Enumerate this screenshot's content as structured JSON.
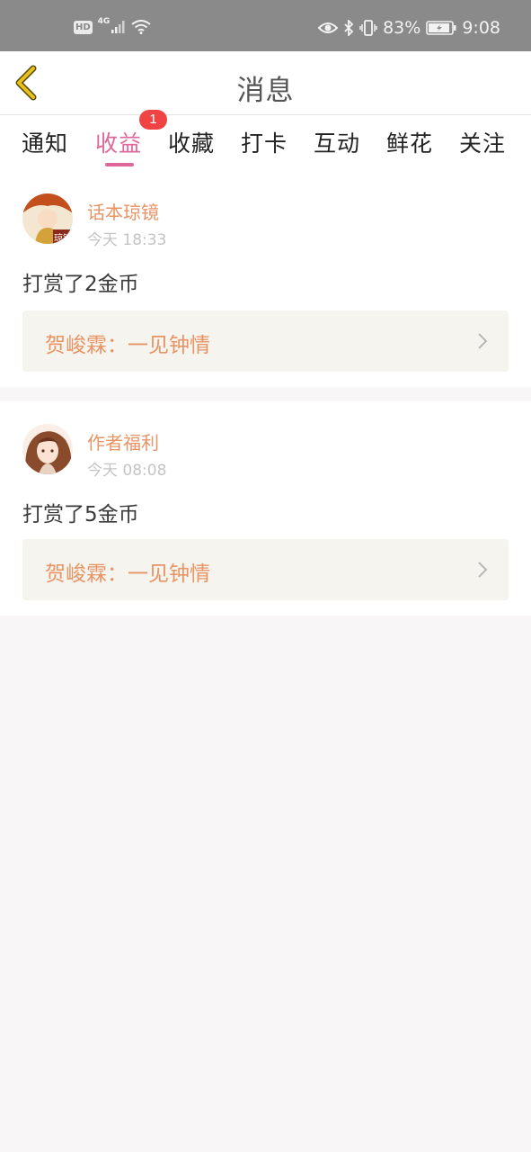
{
  "status_bar": {
    "left_indicators": [
      "HD",
      "4G"
    ],
    "battery": "83%",
    "time": "9:08",
    "icons": [
      "signal-icon",
      "wifi-icon",
      "eye-icon",
      "bluetooth-icon",
      "vibrate-icon",
      "battery-icon"
    ]
  },
  "header": {
    "title": "消息",
    "back_icon": "chevron-left-icon"
  },
  "tabs": [
    {
      "label": "通知"
    },
    {
      "label": "收益",
      "active": true,
      "badge": "1"
    },
    {
      "label": "收藏"
    },
    {
      "label": "打卡"
    },
    {
      "label": "互动"
    },
    {
      "label": "鲜花"
    },
    {
      "label": "关注"
    }
  ],
  "messages": [
    {
      "sender": "话本琼镜",
      "time": "今天 18:33",
      "text": "打赏了2金币",
      "book": "贺峻霖：一见钟情",
      "avatar_text": "琼镜"
    },
    {
      "sender": "作者福利",
      "time": "今天 08:08",
      "text": "打赏了5金币",
      "book": "贺峻霖：一见钟情"
    }
  ],
  "colors": {
    "accent": "#e0679b",
    "sender": "#e89465",
    "badge": "#f04444",
    "status_bar": "#8a8a8a",
    "back_icon": "#e8c21a",
    "page_bg": "#f8f6f6"
  }
}
